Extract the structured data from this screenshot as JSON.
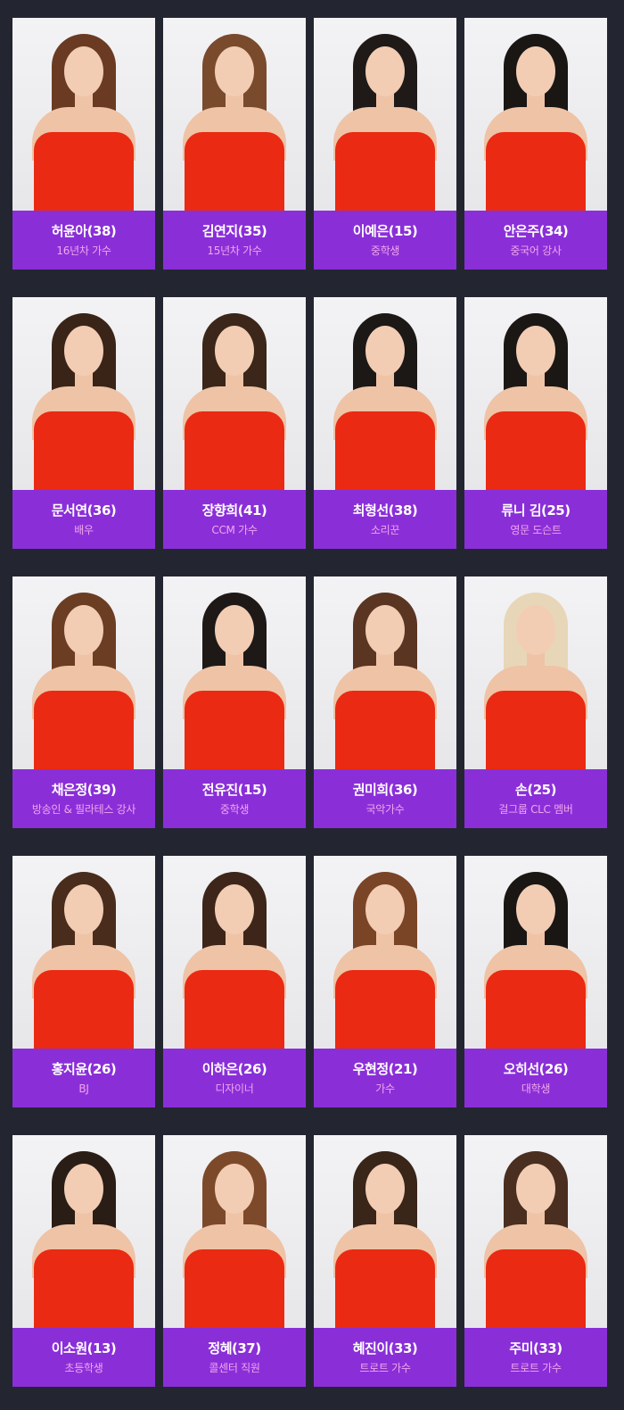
{
  "colors": {
    "background": "#232631",
    "label_bg": "#8a2fd8",
    "name": "#ffffff",
    "job": "#f1a6ee",
    "dress": "#ea2a12"
  },
  "rows": [
    {
      "cards": [
        {
          "name": "허윤아(38)",
          "job": "16년차 가수",
          "hair": "#6a3b22"
        },
        {
          "name": "김연지(35)",
          "job": "15년차 가수",
          "hair": "#7a4a2c"
        },
        {
          "name": "이예은(15)",
          "job": "중학생",
          "hair": "#1f1a18"
        },
        {
          "name": "안은주(34)",
          "job": "중국어 강사",
          "hair": "#1a1614"
        }
      ]
    },
    {
      "cards": [
        {
          "name": "문서연(36)",
          "job": "배우",
          "hair": "#3a2418"
        },
        {
          "name": "장향희(41)",
          "job": "CCM 가수",
          "hair": "#3b2619"
        },
        {
          "name": "최형선(38)",
          "job": "소리꾼",
          "hair": "#1c1816"
        },
        {
          "name": "류니 김(25)",
          "job": "영문 도슨트",
          "hair": "#1b1715"
        }
      ]
    },
    {
      "cards": [
        {
          "name": "채은정(39)",
          "job": "방송인 & 필라테스 강사",
          "hair": "#6b3d22"
        },
        {
          "name": "전유진(15)",
          "job": "중학생",
          "hair": "#1e1917"
        },
        {
          "name": "권미희(36)",
          "job": "국악가수",
          "hair": "#5a3521"
        },
        {
          "name": "손(25)",
          "job": "걸그룹 CLC 멤버",
          "hair": "#e8d6b8"
        }
      ]
    },
    {
      "cards": [
        {
          "name": "홍지윤(26)",
          "job": "BJ",
          "hair": "#4a2c1c"
        },
        {
          "name": "이하은(26)",
          "job": "디자이너",
          "hair": "#3d2619"
        },
        {
          "name": "우현정(21)",
          "job": "가수",
          "hair": "#7a4426"
        },
        {
          "name": "오히선(26)",
          "job": "대학생",
          "hair": "#1a1614"
        }
      ]
    },
    {
      "cards": [
        {
          "name": "이소원(13)",
          "job": "초등학생",
          "hair": "#2a1d16"
        },
        {
          "name": "정혜(37)",
          "job": "콜센터 직원",
          "hair": "#7c4a2a"
        },
        {
          "name": "혜진이(33)",
          "job": "트로트 가수",
          "hair": "#3a2519"
        },
        {
          "name": "주미(33)",
          "job": "트로트 가수",
          "hair": "#4a2e1f"
        }
      ]
    }
  ]
}
